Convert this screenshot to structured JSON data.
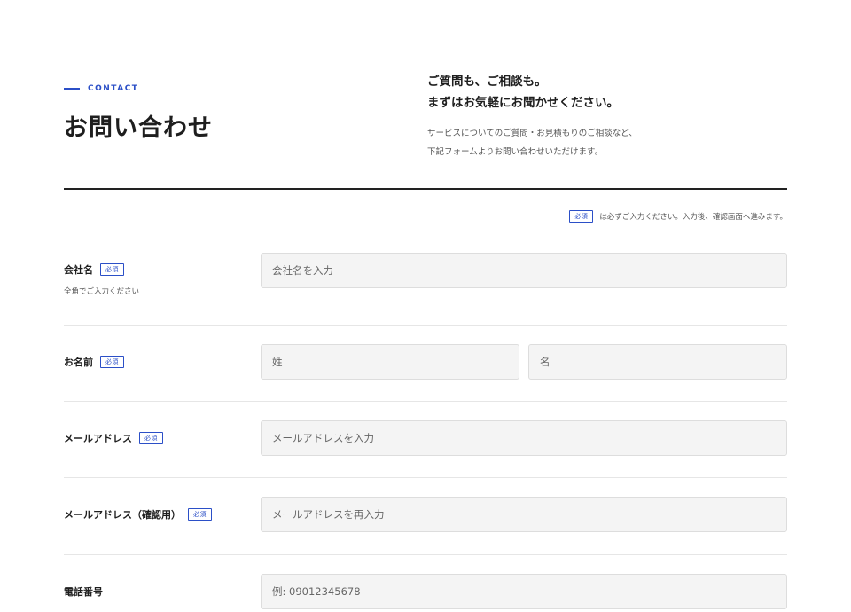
{
  "header": {
    "eyebrow": "CONTACT",
    "title": "お問い合わせ",
    "lead_line1": "ご質問も、ご相談も。",
    "lead_line2": "まずはお気軽にお聞かせください。",
    "desc_line1": "サービスについてのご質問・お見積もりのご相談など、",
    "desc_line2": "下記フォームよりお問い合わせいただけます。"
  },
  "required_badge": "必須",
  "required_note": "は必ずご入力ください。入力後、確認画面へ進みます。",
  "form": {
    "company": {
      "label": "会社名",
      "hint": "全角でご入力ください",
      "placeholder": "会社名を入力",
      "value": ""
    },
    "name": {
      "label": "お名前",
      "last_placeholder": "姓",
      "first_placeholder": "名",
      "last_value": "",
      "first_value": ""
    },
    "email": {
      "label": "メールアドレス",
      "placeholder": "メールアドレスを入力",
      "value": ""
    },
    "email_confirm": {
      "label": "メールアドレス（確認用）",
      "placeholder": "メールアドレスを再入力",
      "value": ""
    },
    "phone": {
      "label": "電話番号",
      "placeholder": "例: 09012345678",
      "value": ""
    }
  },
  "colors": {
    "accent": "#2b4fc7",
    "text": "#1e1e1e",
    "field_bg": "#f4f4f4"
  }
}
